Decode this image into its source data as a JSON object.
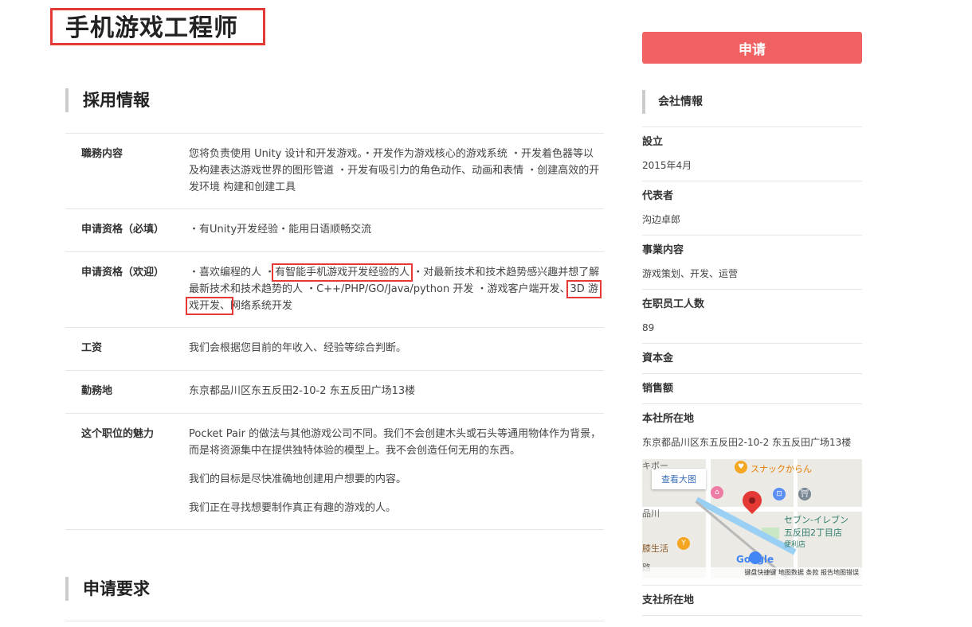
{
  "page": {
    "job_title": "手机游戏工程师",
    "apply_label": "申请"
  },
  "sections": {
    "recruitment": "採用情報",
    "application_requirements": "申请要求"
  },
  "details": {
    "duties": {
      "label": "職務内容",
      "value": "您将负责使用 Unity 设计和开发游戏。・开发作为游戏核心的游戏系统 ・开发着色器等以及构建表达游戏世界的图形管道 ・开发有吸引力的角色动作、动画和表情 ・创建高效的开发环境 构建和创建工具"
    },
    "required": {
      "label": "申请资格（必填）",
      "value": "・有Unity开发经验・能用日语顺畅交流"
    },
    "welcome": {
      "label": "申请资格（欢迎）",
      "part1": "・喜欢编程的人 ・",
      "highlight1": "有智能手机游戏开发经验的人",
      "part2": " ・对最新技术和技术趋势感兴趣并想了解最新技术和技术趋势的人 ・C++/PHP/GO/Java/python 开发 ・游戏客户端开发、",
      "highlight2": "3D 游戏开发、",
      "part3": "网络系统开发"
    },
    "salary": {
      "label": "工资",
      "value": "我们会根据您目前的年收入、经验等综合判断。"
    },
    "location": {
      "label": "勤務地",
      "value": "东京都品川区东五反田2-10-2 东五反田广场13楼"
    },
    "appeal": {
      "label": "这个职位的魅力",
      "p1": "Pocket Pair 的做法与其他游戏公司不同。我们不会创建木头或石头等通用物体作为背景，而是将资源集中在提供独特体验的模型上。我不会创造任何无用的东西。",
      "p2": "我们的目标是尽快准确地创建用户想要的内容。",
      "p3": "我们正在寻找想要制作真正有趣的游戏的人。"
    }
  },
  "company": {
    "heading": "会社情報",
    "founded_label": "設立",
    "founded_value": "2015年4月",
    "rep_label": "代表者",
    "rep_value": "沟边卓郎",
    "business_label": "事業内容",
    "business_value": "游戏策划、开发、运营",
    "employees_label": "在职员工人数",
    "employees_value": "89",
    "capital_label": "資本金",
    "sales_label": "销售额",
    "hq_label": "本社所在地",
    "hq_value": "东京都品川区东五反田2-10-2 东五反田广场13楼",
    "branch_label": "支社所在地"
  },
  "map": {
    "view_larger": "查看大图",
    "label_snack": "スナックからん",
    "label_seven": "セブン-イレブン",
    "label_seven2": "五反田2丁目店",
    "label_conv": "便利店",
    "label_life": "膝生活",
    "label_shina": "品川",
    "label_road": "路",
    "label_kibo": "キボー",
    "footer": "键盘快捷键  地图数据  条款  报告地图错误",
    "google": "Google",
    "colors": {
      "pin": "#e53935",
      "water": "#9bd0f5",
      "park": "#c9e7c4"
    }
  },
  "colors": {
    "accent": "#f06262",
    "highlight_box": "#e53935"
  }
}
